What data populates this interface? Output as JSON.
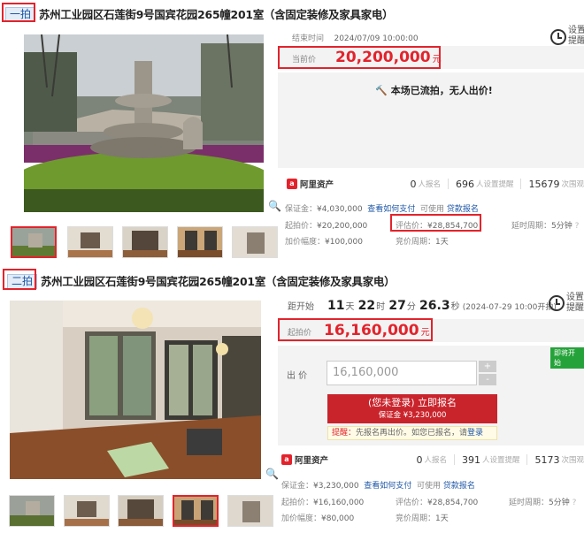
{
  "colors": {
    "accent": "#e3232c",
    "link": "#1e57a7",
    "button": "#c9242c",
    "tag_green": "#25a33a"
  },
  "auction1": {
    "round": "一拍",
    "title": "苏州工业园区石莲街9号国宾花园265幢201室（含固定装修及家具家电）",
    "end_time_label": "结束时间",
    "end_time": "2024/07/09 10:00:00",
    "price_label": "当前价",
    "price": "20,200,000",
    "price_unit": "元",
    "remind": "设置\n提醒",
    "status_msg": "本场已流拍，无人出价!",
    "platform": "阿里资产",
    "stats": {
      "signups": "0",
      "signups_label": "人报名",
      "reminders": "696",
      "reminders_label": "人设置提醒",
      "views": "15679",
      "views_label": "次围观"
    },
    "deposit_label": "保证金：",
    "deposit": "¥4,030,000",
    "how_to_pay": "查看如何支付",
    "can_use": "可使用",
    "loan": "贷款报名",
    "start_price_label": "起拍价：",
    "start_price": "¥20,200,000",
    "appraisal_label": "评估价：",
    "appraisal": "¥28,854,700",
    "delay_label": "延时周期：",
    "delay": "5分钟",
    "increment_label": "加价幅度：",
    "increment": "¥100,000",
    "bid_cycle_label": "竞价周期：",
    "bid_cycle": "1天"
  },
  "auction2": {
    "round": "二拍",
    "title": "苏州工业园区石莲街9号国宾花园265幢201室（含固定装修及家具家电）",
    "countdown_label": "距开始",
    "days": "11",
    "days_unit": "天",
    "hours": "22",
    "hours_unit": "时",
    "minutes": "27",
    "minutes_unit": "分",
    "seconds": "26.3",
    "seconds_unit": "秒",
    "start_time": "(2024-07-29 10:00开拍)",
    "price_label": "起拍价",
    "price": "16,160,000",
    "price_unit": "元",
    "remind": "设置\n提醒",
    "start_tag": "即将开始",
    "bid_label": "出 价",
    "bid_value": "16,160,000",
    "plus": "+",
    "minus": "-",
    "signup_button": "(您未登录) 立即报名",
    "signup_deposit": "保证金 ¥3,230,000",
    "notice_label": "提醒：",
    "notice": "先报名再出价。如您已报名，请",
    "login": "登录",
    "platform": "阿里资产",
    "stats": {
      "signups": "0",
      "signups_label": "人报名",
      "reminders": "391",
      "reminders_label": "人设置提醒",
      "views": "5173",
      "views_label": "次围观"
    },
    "deposit_label": "保证金：",
    "deposit": "¥3,230,000",
    "how_to_pay": "查看如何支付",
    "can_use": "可使用",
    "loan": "贷款报名",
    "start_price_label": "起拍价：",
    "start_price": "¥16,160,000",
    "appraisal_label": "评估价：",
    "appraisal": "¥28,854,700",
    "delay_label": "延时周期：",
    "delay": "5分钟",
    "increment_label": "加价幅度：",
    "increment": "¥80,000",
    "bid_cycle_label": "竞价周期：",
    "bid_cycle": "1天"
  }
}
